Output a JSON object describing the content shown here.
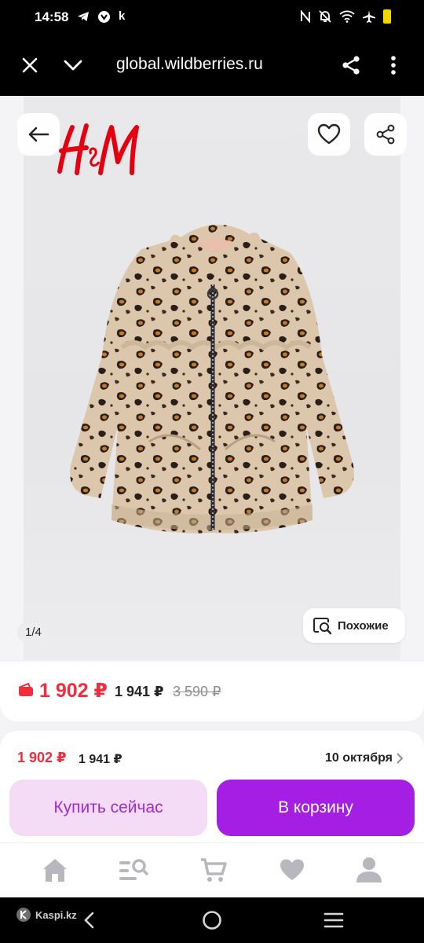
{
  "status_bar": {
    "time": "14:58",
    "left_letter": "k",
    "left_icons": [
      "telegram-icon",
      "app-icon"
    ],
    "right_icons": [
      "nfc-icon",
      "mute-icon",
      "wifi-icon",
      "airplane-icon",
      "battery-icon"
    ]
  },
  "browser": {
    "url": "global.wildberries.ru",
    "close_icon": "close-icon",
    "collapse_icon": "chevron-down-icon",
    "share_icon": "share-icon",
    "menu_icon": "more-vert-icon"
  },
  "gallery": {
    "brand": "H&M",
    "counter": "1/4",
    "similar_label": "Похожие"
  },
  "price": {
    "current": "1 902 ₽",
    "wallet": "1 941 ₽",
    "old": "3 590 ₽"
  },
  "buy_sheet": {
    "price": "1 902 ₽",
    "price_wallet": "1 941 ₽",
    "delivery_date": "10 октября",
    "buy_now_label": "Купить сейчас",
    "add_to_cart_label": "В корзину"
  },
  "tabbar": {
    "items": [
      "home-icon",
      "catalog-search-icon",
      "cart-icon",
      "heart-icon",
      "profile-icon"
    ]
  },
  "navbar": {
    "kaspi_label": "Kaspi.kz"
  },
  "colors": {
    "brand_purple": "#a51ee3",
    "price_red": "#f22b3d",
    "hm_red": "#e50010"
  }
}
